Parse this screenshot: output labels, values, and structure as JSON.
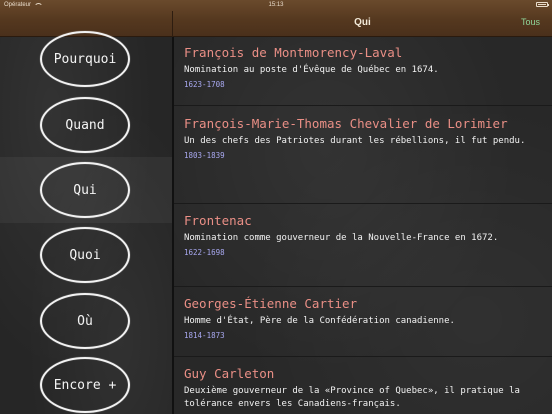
{
  "status": {
    "carrier": "Opérateur",
    "time": "15:13"
  },
  "nav": {
    "title": "Qui",
    "right_button": "Tous"
  },
  "sidebar": {
    "items": [
      {
        "label": "Pourquoi"
      },
      {
        "label": "Quand"
      },
      {
        "label": "Qui"
      },
      {
        "label": "Quoi"
      },
      {
        "label": "Où"
      },
      {
        "label": "Encore +"
      }
    ],
    "selected": "Qui"
  },
  "list": {
    "items": [
      {
        "name": "François de Montmorency-Laval",
        "desc": "Nomination au poste d'Évêque de Québec en 1674.",
        "dates": "1623-1708"
      },
      {
        "name": "François-Marie-Thomas Chevalier de Lorimier",
        "desc": "Un des chefs des Patriotes durant les rébellions, il fut pendu.",
        "dates": "1803-1839"
      },
      {
        "name": "Frontenac",
        "desc": "Nomination comme gouverneur de la Nouvelle-France en 1672.",
        "dates": "1622-1698"
      },
      {
        "name": "Georges-Étienne Cartier",
        "desc": "Homme d'État, Père de la Confédération canadienne.",
        "dates": "1814-1873"
      },
      {
        "name": "Guy Carleton",
        "desc": "Deuxième gouverneur de la «Province of Quebec», il pratique la tolérance envers les Canadiens-français.",
        "dates": ""
      }
    ]
  },
  "colors": {
    "name": "#ea8f86",
    "dates": "#a8a8f0",
    "accent_button": "#8fd69a",
    "wood": "#55381f"
  }
}
